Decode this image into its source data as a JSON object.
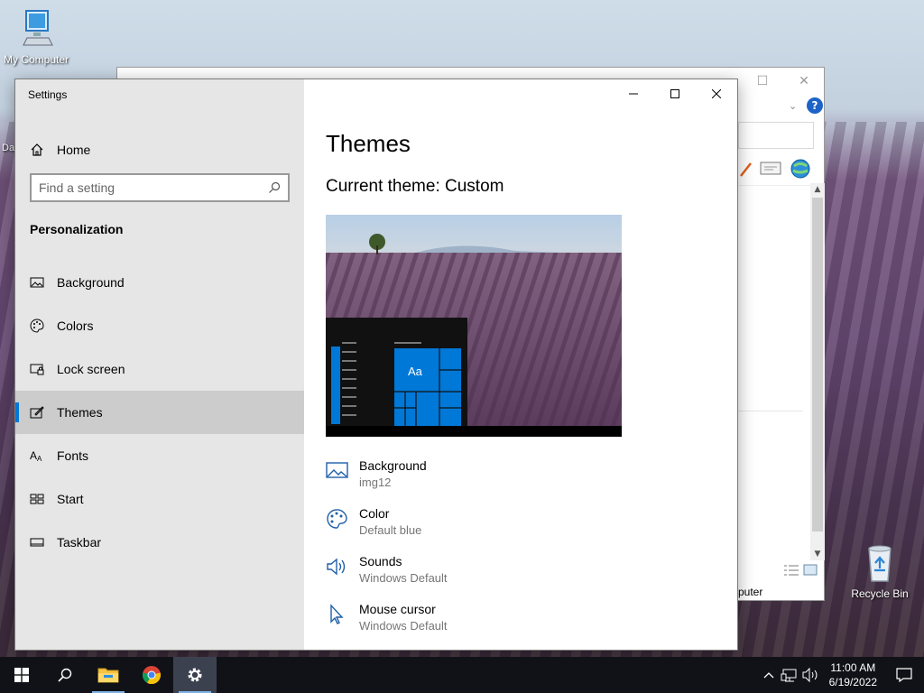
{
  "desktop": {
    "icons": [
      {
        "label": "My Computer"
      },
      {
        "label": "Recycle Bin"
      }
    ],
    "partial_label": "Da"
  },
  "explorer": {
    "status_text": "puter"
  },
  "settings": {
    "window_title": "Settings",
    "home_label": "Home",
    "search": {
      "placeholder": "Find a setting"
    },
    "section_title": "Personalization",
    "nav": [
      {
        "label": "Background",
        "icon": "picture-icon"
      },
      {
        "label": "Colors",
        "icon": "palette-icon"
      },
      {
        "label": "Lock screen",
        "icon": "lock-screen-icon"
      },
      {
        "label": "Themes",
        "icon": "themes-icon",
        "active": true
      },
      {
        "label": "Fonts",
        "icon": "fonts-icon"
      },
      {
        "label": "Start",
        "icon": "start-icon"
      },
      {
        "label": "Taskbar",
        "icon": "taskbar-icon"
      }
    ],
    "page_title": "Themes",
    "current_theme": "Current theme: Custom",
    "preview_tile_text": "Aa",
    "options": [
      {
        "title": "Background",
        "value": "img12",
        "icon": "picture-icon"
      },
      {
        "title": "Color",
        "value": "Default blue",
        "icon": "palette-icon"
      },
      {
        "title": "Sounds",
        "value": "Windows Default",
        "icon": "speaker-icon"
      },
      {
        "title": "Mouse cursor",
        "value": "Windows Default",
        "icon": "cursor-icon"
      }
    ]
  },
  "taskbar": {
    "time": "11:00 AM",
    "date": "6/19/2022"
  },
  "colors": {
    "accent": "#0078d7",
    "sidebar_bg": "#e6e6e6",
    "taskbar_bg": "#101217"
  }
}
